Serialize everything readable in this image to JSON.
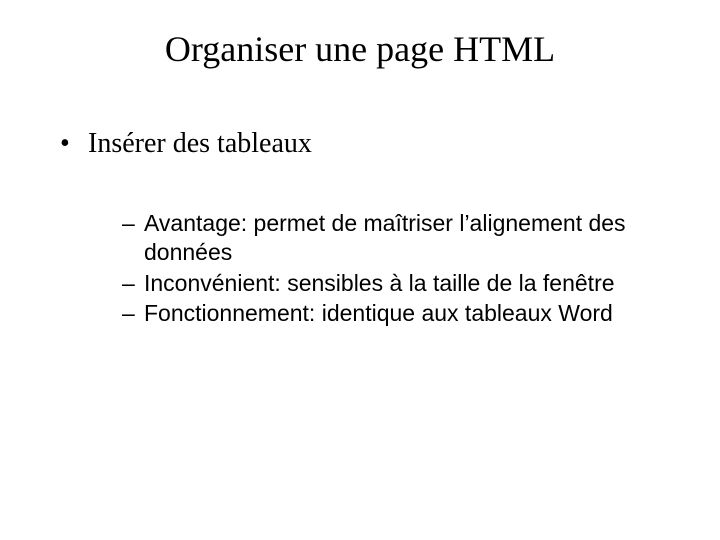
{
  "title": "Organiser une page HTML",
  "bullet1": "Insérer des tableaux",
  "sub1": "Avantage: permet de maîtriser l’alignement des données",
  "sub2": "Inconvénient: sensibles à la taille de la fenêtre",
  "sub3": "Fonctionnement: identique aux tableaux Word"
}
